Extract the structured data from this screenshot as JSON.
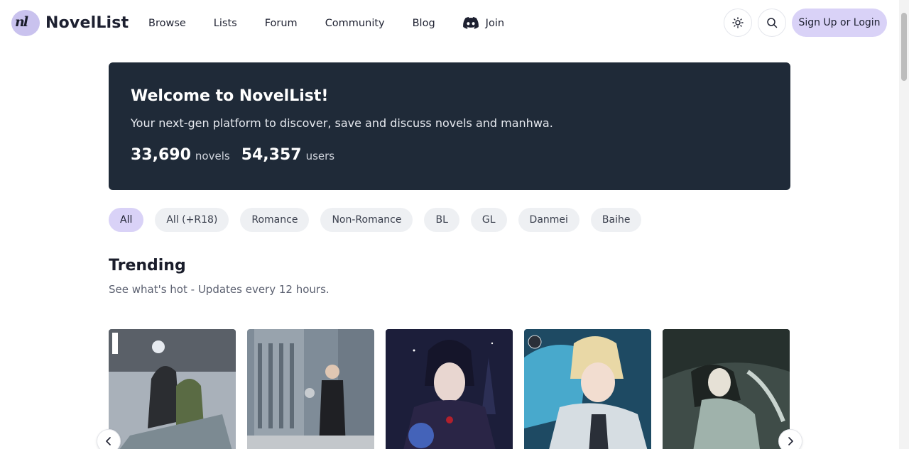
{
  "brand": {
    "name": "NovelList",
    "mark": "nl"
  },
  "nav": {
    "items": [
      "Browse",
      "Lists",
      "Forum",
      "Community",
      "Blog"
    ],
    "join_label": "Join"
  },
  "header": {
    "login_label": "Sign Up or Login"
  },
  "hero": {
    "title": "Welcome to NovelList!",
    "subtitle": "Your next-gen platform to discover, save and discuss novels and manhwa.",
    "novels_count": "33,690",
    "novels_label": "novels",
    "users_count": "54,357",
    "users_label": "users"
  },
  "filters": [
    "All",
    "All (+R18)",
    "Romance",
    "Non-Romance",
    "BL",
    "GL",
    "Danmei",
    "Baihe"
  ],
  "active_filter": "All",
  "trending": {
    "title": "Trending",
    "subtitle": "See what's hot - Updates every 12 hours."
  },
  "covers": [
    {
      "name": "cover-1",
      "palette": [
        "#9aa3ad",
        "#3b3f46",
        "#6e8a5a"
      ]
    },
    {
      "name": "cover-2",
      "palette": [
        "#8a97a4",
        "#2a2c31",
        "#c7cbd0"
      ]
    },
    {
      "name": "cover-3",
      "palette": [
        "#1f2240",
        "#3a2f5e",
        "#4a6fd1"
      ]
    },
    {
      "name": "cover-4",
      "palette": [
        "#1f4a66",
        "#e7d9b7",
        "#4fb3d9"
      ]
    },
    {
      "name": "cover-5",
      "palette": [
        "#4a5a55",
        "#a7b4ae",
        "#2e3a36"
      ]
    }
  ],
  "colors": {
    "accent": "#d9d2f7",
    "hero_bg": "#1f2a38"
  }
}
